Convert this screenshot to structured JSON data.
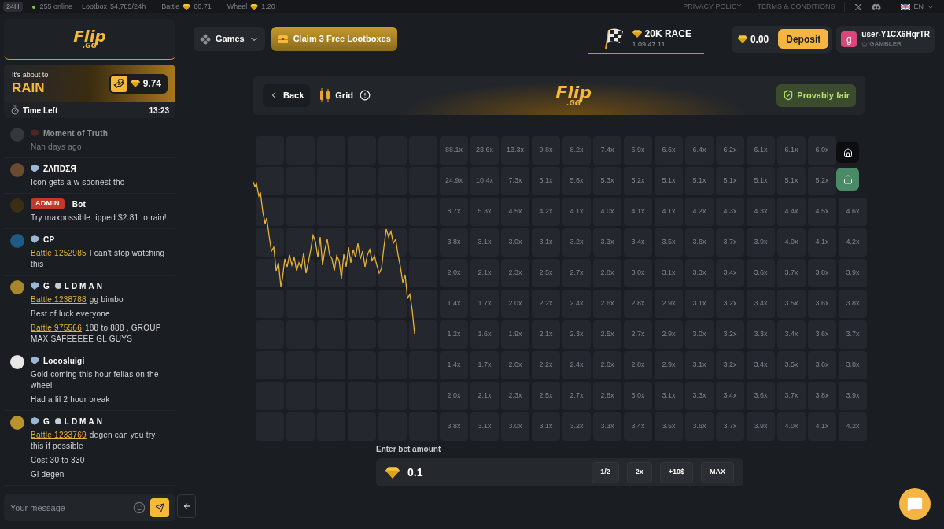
{
  "top_bar": {
    "period": "24H",
    "online": "255 online",
    "stats": [
      {
        "label": "Lootbox",
        "value": "54,785/24h",
        "gem": false
      },
      {
        "label": "Battle",
        "value": "60.71",
        "gem": true
      },
      {
        "label": "Wheel",
        "value": "1.20",
        "gem": true
      }
    ],
    "links": [
      "PRIVACY POLICY",
      "TERMS & CONDITIONS"
    ],
    "language": "EN"
  },
  "logo": {
    "name": "Flip",
    "suffix": ".GG"
  },
  "game_logo": {
    "name": "Flip",
    "suffix": ".GG"
  },
  "rain": {
    "intro": "It's about to",
    "title": "RAIN",
    "amount": "9.74",
    "time_label": "Time Left",
    "time": "13:23"
  },
  "chat": {
    "messages": [
      {
        "name": [
          "Moment of Truth"
        ],
        "faded": true,
        "admin": false,
        "color": "#34373c",
        "lines": [
          {
            "text": "Nah days ago"
          }
        ]
      },
      {
        "name": [
          "ZΛΠDΣЯ"
        ],
        "faded": false,
        "admin": false,
        "color": "#6b4a32",
        "lines": [
          {
            "text": "Icon gets a w soonest tho"
          }
        ]
      },
      {
        "name": [
          "Bot"
        ],
        "faded": false,
        "admin": true,
        "badge": "ADMIN",
        "color": "#3a2e14",
        "lines": [
          {
            "text": "Try maxpossible tipped $2.81 to rain!"
          }
        ]
      },
      {
        "name": [
          "CP"
        ],
        "faded": false,
        "admin": false,
        "color": "#1f5a86",
        "lines": [
          {
            "link": "Battle 1252985",
            "text": "I can't stop watching this"
          }
        ]
      },
      {
        "name": [
          "G",
          "LDMAN"
        ],
        "faded": false,
        "admin": false,
        "color": "#a8862c",
        "lines": [
          {
            "link": "Battle 1238788",
            "text": "gg bimbo"
          },
          {
            "text": "Best of luck everyone"
          },
          {
            "link": "Battle 975566",
            "text": "188 to 888 , GROUP MAX SAFEEEEE GL GUYS"
          }
        ]
      },
      {
        "name": [
          "Locosluigi"
        ],
        "faded": false,
        "admin": false,
        "color": "#e8e8e8",
        "lines": [
          {
            "text": "Gold coming this hour fellas on the wheel"
          },
          {
            "text": "Had a lil 2 hour break"
          }
        ]
      },
      {
        "name": [
          "G",
          "LDMAN"
        ],
        "faded": false,
        "admin": false,
        "color": "#b8922c",
        "lines": [
          {
            "link": "Battle 1233769",
            "text": "degen can you try this if possible"
          },
          {
            "text": "Cost 30 to 330"
          },
          {
            "text": "Gl degen"
          }
        ]
      }
    ],
    "input": {
      "placeholder": "Your message"
    }
  },
  "header": {
    "games": "Games",
    "claim": "Claim 3 Free Lootboxes",
    "race": {
      "title": "20K RACE",
      "time": "1:09:47:11"
    },
    "balance": "0.00",
    "deposit": "Deposit",
    "user": {
      "initial": "g",
      "name": "user-Y1CX6HqrTR",
      "rank": "GAMBLER"
    }
  },
  "game": {
    "back": "Back",
    "title": "Grid",
    "fair": "Provably fair",
    "rows": [
      [
        "88.1x",
        "23.6x",
        "13.3x",
        "9.8x",
        "8.2x",
        "7.4x",
        "6.9x",
        "6.6x",
        "6.4x",
        "6.2x",
        "6.1x",
        "6.1x",
        "6.0x"
      ],
      [
        "24.9x",
        "10.4x",
        "7.3x",
        "6.1x",
        "5.6x",
        "5.3x",
        "5.2x",
        "5.1x",
        "5.1x",
        "5.1x",
        "5.1x",
        "5.1x",
        "5.2x"
      ],
      [
        "8.7x",
        "5.3x",
        "4.5x",
        "4.2x",
        "4.1x",
        "4.0x",
        "4.1x",
        "4.1x",
        "4.2x",
        "4.3x",
        "4.3x",
        "4.4x",
        "4.5x",
        "4.6x"
      ],
      [
        "3.8x",
        "3.1x",
        "3.0x",
        "3.1x",
        "3.2x",
        "3.3x",
        "3.4x",
        "3.5x",
        "3.6x",
        "3.7x",
        "3.9x",
        "4.0x",
        "4.1x",
        "4.2x"
      ],
      [
        "2.0x",
        "2.1x",
        "2.3x",
        "2.5x",
        "2.7x",
        "2.8x",
        "3.0x",
        "3.1x",
        "3.3x",
        "3.4x",
        "3.6x",
        "3.7x",
        "3.8x",
        "3.9x"
      ],
      [
        "1.4x",
        "1.7x",
        "2.0x",
        "2.2x",
        "2.4x",
        "2.6x",
        "2.8x",
        "2.9x",
        "3.1x",
        "3.2x",
        "3.4x",
        "3.5x",
        "3.6x",
        "3.8x"
      ],
      [
        "1.2x",
        "1.6x",
        "1.9x",
        "2.1x",
        "2.3x",
        "2.5x",
        "2.7x",
        "2.9x",
        "3.0x",
        "3.2x",
        "3.3x",
        "3.4x",
        "3.6x",
        "3.7x"
      ],
      [
        "1.4x",
        "1.7x",
        "2.0x",
        "2.2x",
        "2.4x",
        "2.6x",
        "2.8x",
        "2.9x",
        "3.1x",
        "3.2x",
        "3.4x",
        "3.5x",
        "3.6x",
        "3.8x"
      ],
      [
        "2.0x",
        "2.1x",
        "2.3x",
        "2.5x",
        "2.7x",
        "2.8x",
        "3.0x",
        "3.1x",
        "3.3x",
        "3.4x",
        "3.6x",
        "3.7x",
        "3.8x",
        "3.9x"
      ],
      [
        "3.8x",
        "3.1x",
        "3.0x",
        "3.1x",
        "3.2x",
        "3.3x",
        "3.4x",
        "3.5x",
        "3.6x",
        "3.7x",
        "3.9x",
        "4.0x",
        "4.1x",
        "4.2x"
      ]
    ],
    "bet": {
      "label": "Enter bet amount",
      "value": "0.1",
      "buttons": [
        "1/2",
        "2x",
        "+10$",
        "MAX"
      ]
    }
  }
}
